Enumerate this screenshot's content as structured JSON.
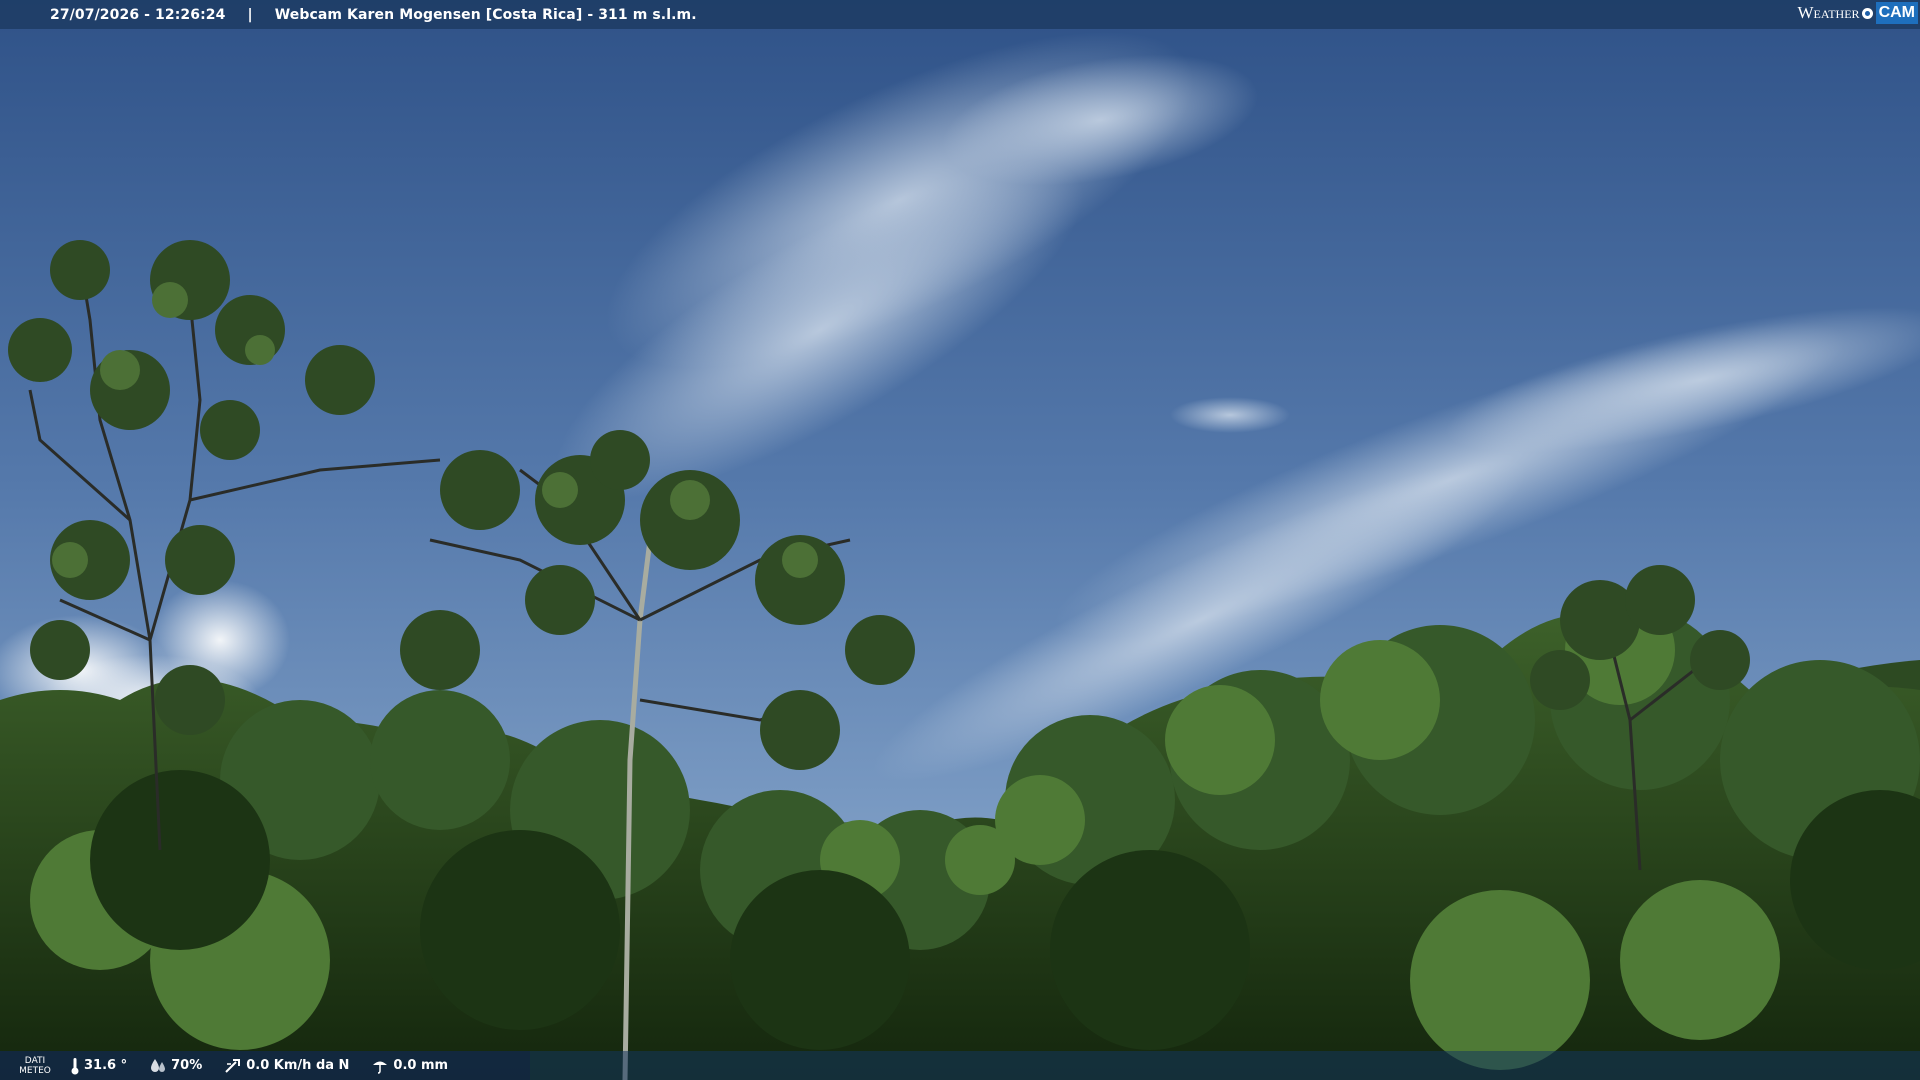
{
  "header": {
    "datetime": "27/07/2026 - 12:26:24",
    "separator": "|",
    "title": "Webcam Karen Mogensen [Costa Rica]  - 311 m s.l.m."
  },
  "brand": {
    "word": "Weather",
    "cam": "CAM"
  },
  "meteo": {
    "label_line1": "DATI",
    "label_line2": "METEO",
    "temperature": "31.6 °",
    "humidity": "70%",
    "wind": "0.0 Km/h da N",
    "rain": "0.0 mm",
    "icons": [
      "thermometer-icon",
      "humidity-drop-icon",
      "wind-icon",
      "rain-gauge-icon"
    ]
  },
  "colors": {
    "sky_top": "#34568a",
    "sky_mid": "#5d81b0",
    "foliage_dark": "#1c3414",
    "foliage_mid": "#3a5e28",
    "foliage_light": "#5f8a42"
  }
}
